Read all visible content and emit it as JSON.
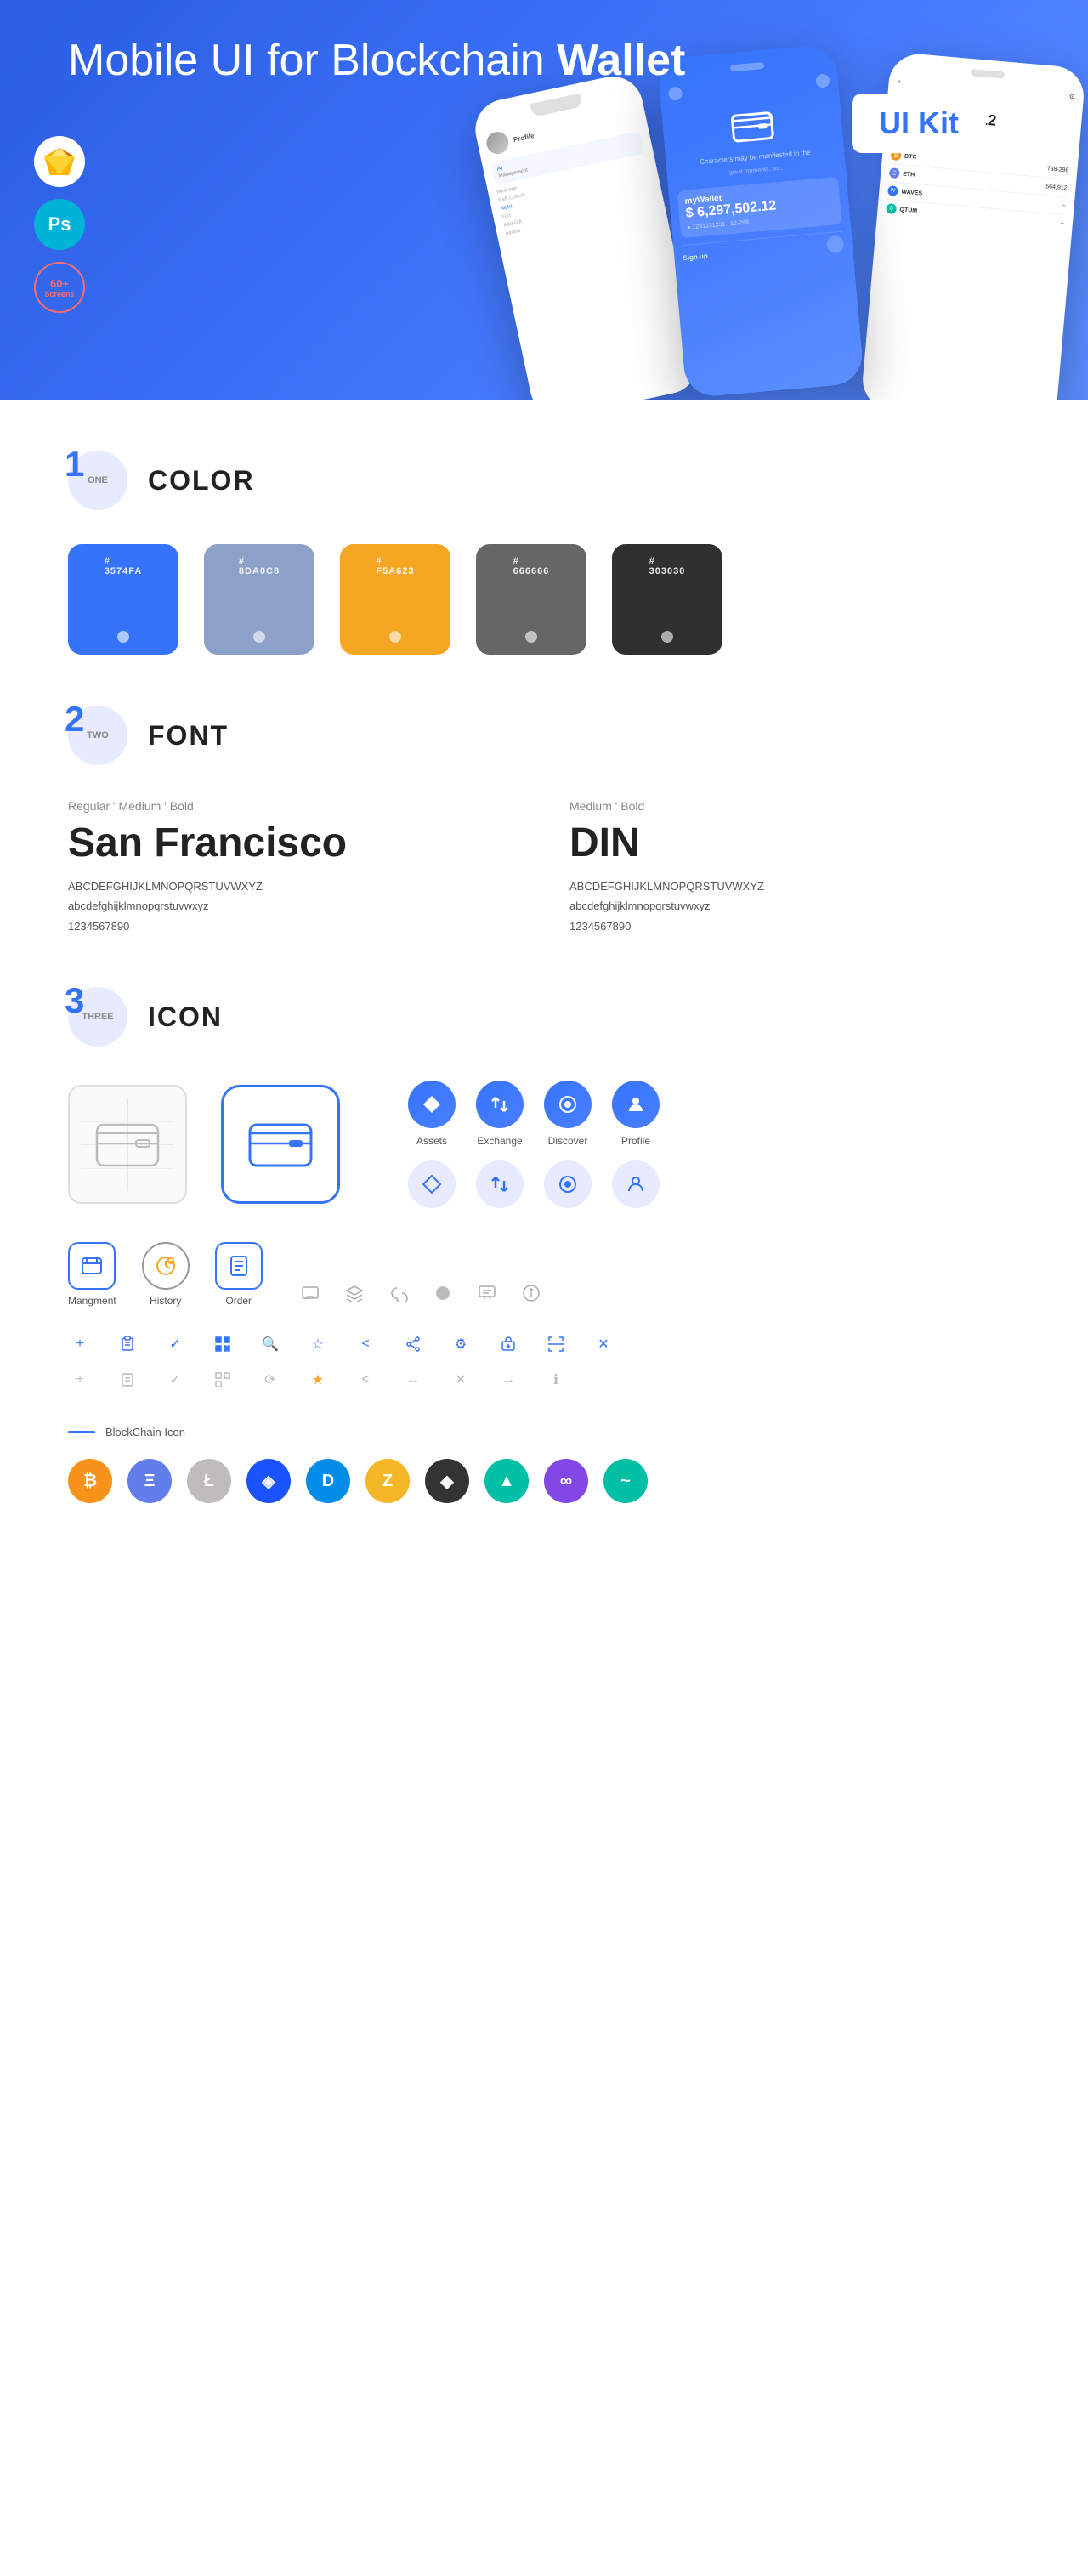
{
  "hero": {
    "title_light": "Mobile UI for Blockchain ",
    "title_bold": "Wallet",
    "badge": "UI Kit",
    "sketch_label": "Sketch",
    "ps_label": "Ps",
    "screens_count": "60+",
    "screens_label": "Screens"
  },
  "sections": {
    "color": {
      "number": "1",
      "number_label": "ONE",
      "title": "COLOR",
      "swatches": [
        {
          "hex": "#3574FA",
          "label": "#\n3574FA",
          "bg": "#3574FA"
        },
        {
          "hex": "#8DA0C8",
          "label": "#\n8DA0C8",
          "bg": "#8DA0C8"
        },
        {
          "hex": "#F5A623",
          "label": "#\nF5A623",
          "bg": "#F5A623"
        },
        {
          "hex": "#666666",
          "label": "#\n666666",
          "bg": "#666666"
        },
        {
          "hex": "#303030",
          "label": "#\n303030",
          "bg": "#303030"
        }
      ]
    },
    "font": {
      "number": "2",
      "number_label": "TWO",
      "title": "FONT",
      "left": {
        "weights": "Regular ' Medium ' Bold",
        "name": "San Francisco",
        "uppercase": "ABCDEFGHIJKLMNOPQRSTUVWXYZ",
        "lowercase": "abcdefghijklmnopqrstuvwxyz",
        "numbers": "1234567890"
      },
      "right": {
        "weights": "Medium ' Bold",
        "name": "DIN",
        "uppercase": "ABCDEFGHIJKLMNOPQRSTUVWXYZ",
        "lowercase": "abcdefghijklmnopqrstuvwxyz",
        "numbers": "1234567890"
      }
    },
    "icon": {
      "number": "3",
      "number_label": "THREE",
      "title": "ICON",
      "named_icons": [
        {
          "label": "Assets",
          "icon": "◈"
        },
        {
          "label": "Exchange",
          "icon": "⇌"
        },
        {
          "label": "Discover",
          "icon": "◉"
        },
        {
          "label": "Profile",
          "icon": "◔"
        }
      ],
      "bottom_icons": [
        {
          "label": "Mangment",
          "type": "sq"
        },
        {
          "label": "History",
          "type": "circle"
        },
        {
          "label": "Order",
          "type": "sq"
        }
      ],
      "small_icons_row1": [
        "+",
        "⊞",
        "✓",
        "⊟",
        "🔍",
        "☆",
        "<",
        "<",
        "⚙",
        "↗",
        "⇄",
        "✕"
      ],
      "small_icons_row2": [
        "+",
        "⊞",
        "✓",
        "⊟",
        "⟳",
        "★",
        "<",
        "↔",
        "✕",
        "→",
        "ℹ"
      ],
      "blockchain_label": "BlockChain Icon",
      "crypto_coins": [
        {
          "symbol": "₿",
          "class": "crypto-btc",
          "name": "Bitcoin"
        },
        {
          "symbol": "Ξ",
          "class": "crypto-eth",
          "name": "Ethereum"
        },
        {
          "symbol": "Ł",
          "class": "crypto-ltc",
          "name": "Litecoin"
        },
        {
          "symbol": "W",
          "class": "crypto-waves",
          "name": "Waves"
        },
        {
          "symbol": "D",
          "class": "crypto-dash",
          "name": "Dash"
        },
        {
          "symbol": "Z",
          "class": "crypto-zcash",
          "name": "ZCash"
        },
        {
          "symbol": "◈",
          "class": "crypto-iota",
          "name": "IOTA"
        },
        {
          "symbol": "△",
          "class": "crypto-aion",
          "name": "AION"
        },
        {
          "symbol": "M",
          "class": "crypto-matic",
          "name": "MATIC"
        },
        {
          "symbol": "~",
          "class": "crypto-sky",
          "name": "Sky"
        }
      ]
    }
  }
}
